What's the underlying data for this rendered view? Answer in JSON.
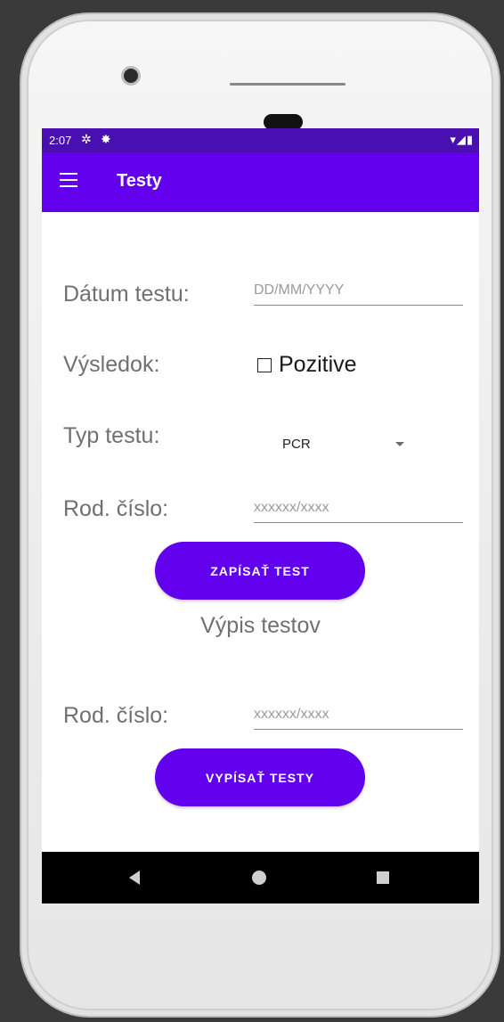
{
  "status_bar": {
    "time": "2:07",
    "left_icons": [
      "gear-icon",
      "sun-icon"
    ],
    "right_icons": [
      "wifi-icon",
      "signal-icon",
      "battery-icon"
    ]
  },
  "app_bar": {
    "title": "Testy",
    "menu_icon": "hamburger-menu-icon"
  },
  "form": {
    "date_label": "Dátum testu:",
    "date_placeholder": "DD/MM/YYYY",
    "result_label": "Výsledok:",
    "result_checkbox_label": "Pozitive",
    "result_checked": false,
    "type_label": "Typ testu:",
    "type_selected": "PCR",
    "id_label": "Rod. číslo:",
    "id_placeholder": "xxxxxx/xxxx",
    "submit_label": "ZAPÍSAŤ TEST"
  },
  "listing": {
    "title": "Výpis testov",
    "id_label": "Rod. číslo:",
    "id_placeholder": "xxxxxx/xxxx",
    "submit_label": "VYPÍSAŤ TESTY"
  },
  "colors": {
    "primary": "#6200ee",
    "status_bar": "#4a0fb0"
  }
}
